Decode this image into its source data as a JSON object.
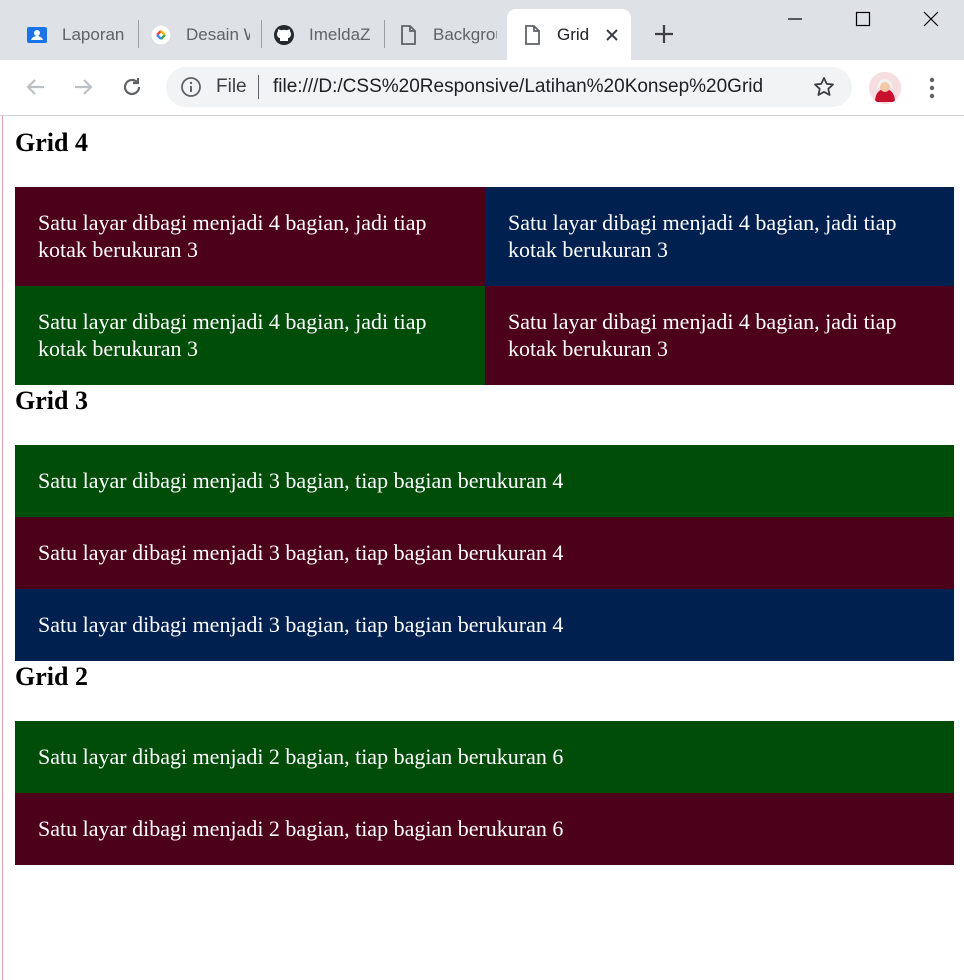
{
  "browser": {
    "tabs": [
      {
        "label": "Laporan",
        "icon": "user-card-icon"
      },
      {
        "label": "Desain W",
        "icon": "google-design-icon"
      },
      {
        "label": "ImeldaZ",
        "icon": "github-icon"
      },
      {
        "label": "Backgrou",
        "icon": "file-icon"
      },
      {
        "label": "Grid",
        "icon": "file-icon",
        "active": true
      }
    ],
    "omnibox": {
      "scheme_label": "File",
      "url": "file:///D:/CSS%20Responsive/Latihan%20Konsep%20Grid"
    }
  },
  "page": {
    "sections": [
      {
        "title": "Grid 4",
        "boxes": [
          "Satu layar dibagi menjadi 4 bagian, jadi tiap kotak berukuran 3",
          "Satu layar dibagi menjadi 4 bagian, jadi tiap kotak berukuran 3",
          "Satu layar dibagi menjadi 4 bagian, jadi tiap kotak berukuran 3",
          "Satu layar dibagi menjadi 4 bagian, jadi tiap kotak berukuran 3"
        ]
      },
      {
        "title": "Grid 3",
        "boxes": [
          "Satu layar dibagi menjadi 3 bagian, tiap bagian berukuran 4",
          "Satu layar dibagi menjadi 3 bagian, tiap bagian berukuran 4",
          "Satu layar dibagi menjadi 3 bagian, tiap bagian berukuran 4"
        ]
      },
      {
        "title": "Grid 2",
        "boxes": [
          "Satu layar dibagi menjadi 2 bagian, tiap bagian berukuran 6",
          "Satu layar dibagi menjadi 2 bagian, tiap bagian berukuran 6"
        ]
      }
    ]
  },
  "colors": {
    "maroon": "#4d0019",
    "navy": "#002050",
    "green": "#004d0a"
  }
}
